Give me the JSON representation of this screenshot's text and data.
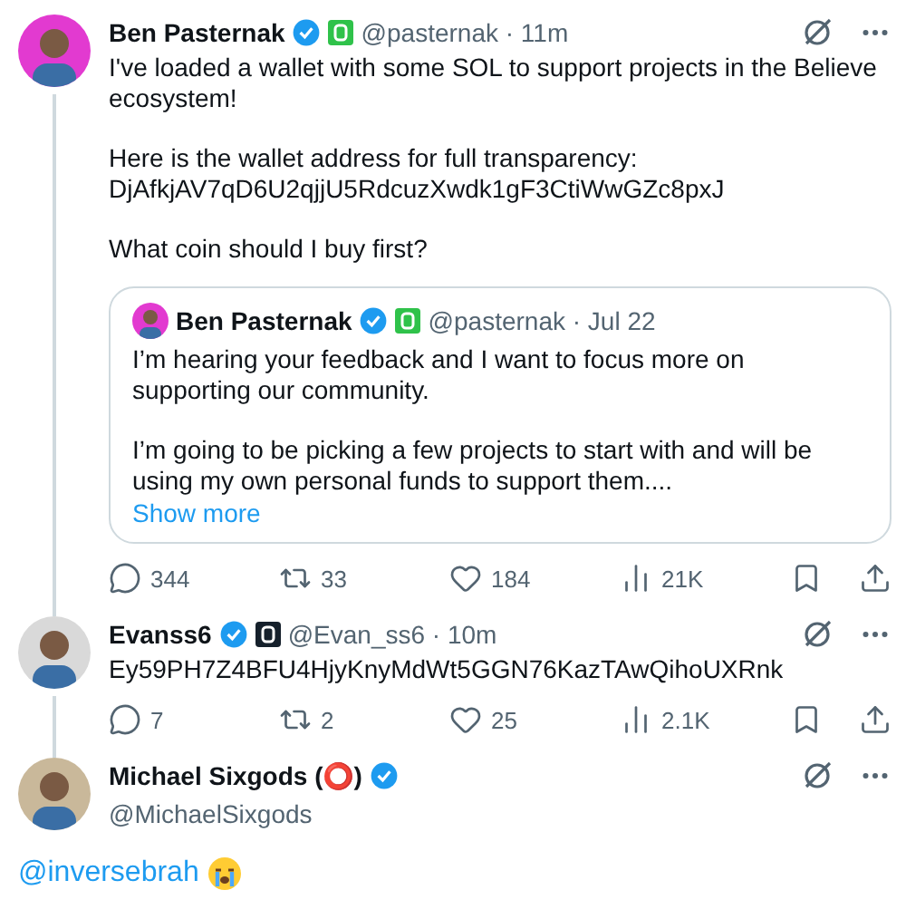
{
  "tweets": [
    {
      "kind": "reply",
      "name": "Ben Pasternak",
      "meta": "@pasternak · 11m",
      "badge": {
        "color": "#2fc24a"
      },
      "thread_below": true,
      "paragraphs": [
        "I've loaded a wallet with some SOL to support projects in the Believe ecosystem!",
        "Here is the wallet address for full transparency: DjAfkjAV7qD6U2qjjU5RdcuzXwdk1gF3CtiWwGZc8pxJ",
        "What coin should I buy first?"
      ],
      "quote": {
        "name": "Ben Pasternak",
        "meta": "@pasternak · Jul 22",
        "badge": {
          "color": "#2fc24a"
        },
        "paragraphs": [
          "I’m hearing your feedback and I want to focus more on supporting our community.",
          "I’m going to be picking a few projects to start with and will be using my own personal funds to support them...."
        ],
        "more": "Show more"
      },
      "actions": [
        {
          "kind": "reply",
          "count": "344"
        },
        {
          "kind": "repost",
          "count": "33"
        },
        {
          "kind": "like",
          "count": "184"
        },
        {
          "kind": "views",
          "count": "21K"
        },
        {
          "kind": "bookmark"
        },
        {
          "kind": "share"
        }
      ]
    },
    {
      "kind": "reply",
      "name": "Evanss6",
      "meta": "@Evan_ss6 · 10m",
      "badge": {
        "color": "#15202b"
      },
      "thread_below": true,
      "paragraphs": [
        "Ey59PH7Z4BFU4HjyKnyMdWt5GGN76KazTAwQihoUXRnk"
      ],
      "actions": [
        {
          "kind": "reply",
          "count": "7"
        },
        {
          "kind": "repost",
          "count": "2"
        },
        {
          "kind": "like",
          "count": "25"
        },
        {
          "kind": "views",
          "count": "2.1K"
        },
        {
          "kind": "bookmark"
        },
        {
          "kind": "share"
        }
      ]
    },
    {
      "kind": "focused",
      "name": "Michael Sixgods (⭕)",
      "meta": "@MichaelSixgods",
      "mention": "@inversebrah"
    }
  ]
}
